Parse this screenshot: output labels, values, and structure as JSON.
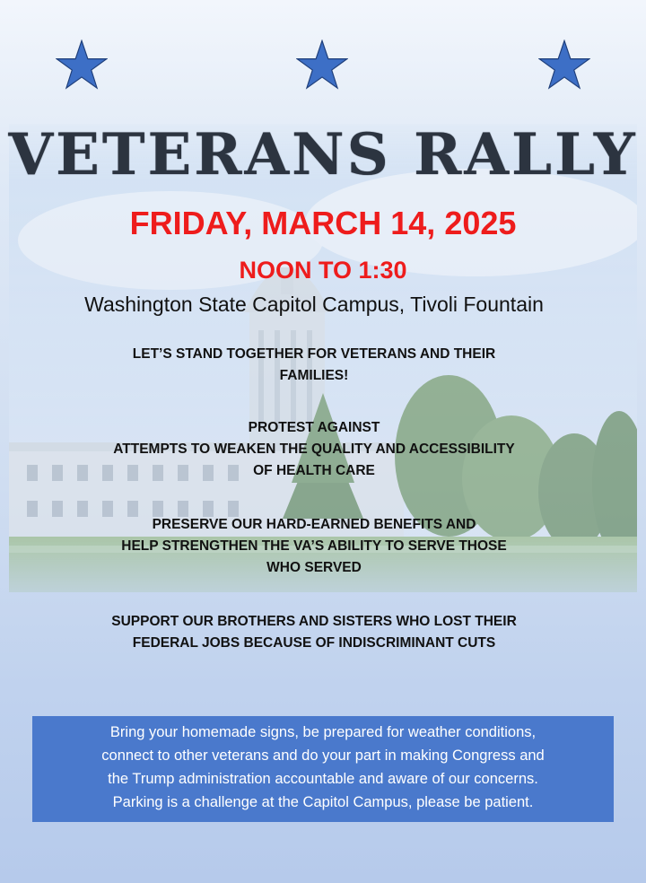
{
  "colors": {
    "star": "#3d6fc6",
    "title": "#2c3440",
    "date": "#ee1c1c",
    "box_background": "#4a79cc",
    "box_text": "#ffffff"
  },
  "icons": {
    "decoration": [
      "star-icon",
      "star-icon",
      "star-icon"
    ],
    "background_image": "capitol-building-photo"
  },
  "flyer": {
    "title": "VETERANS RALLY",
    "date": "FRIDAY, MARCH 14, 2025",
    "time": "NOON TO 1:30",
    "location": "Washington State Capitol Campus, Tivoli Fountain",
    "messages": [
      {
        "lines": [
          "LET’S STAND TOGETHER FOR VETERANS AND THEIR",
          "FAMILIES!"
        ]
      },
      {
        "lines": [
          "PROTEST AGAINST",
          "ATTEMPTS TO WEAKEN THE QUALITY AND ACCESSIBILITY",
          "OF HEALTH CARE"
        ]
      },
      {
        "lines": [
          "PRESERVE OUR HARD-EARNED BENEFITS AND",
          "HELP STRENGTHEN THE VA’S ABILITY TO SERVE THOSE",
          "WHO SERVED"
        ]
      },
      {
        "lines": [
          "SUPPORT OUR BROTHERS AND SISTERS WHO LOST THEIR",
          "FEDERAL JOBS BECAUSE OF INDISCRIMINANT CUTS"
        ]
      }
    ],
    "info_box": {
      "lines": [
        "Bring your homemade signs, be prepared for weather conditions,",
        "connect to other veterans and do your part in making Congress and",
        "the Trump administration accountable and aware of our concerns.",
        "Parking is a challenge at the Capitol Campus, please be patient."
      ]
    }
  }
}
